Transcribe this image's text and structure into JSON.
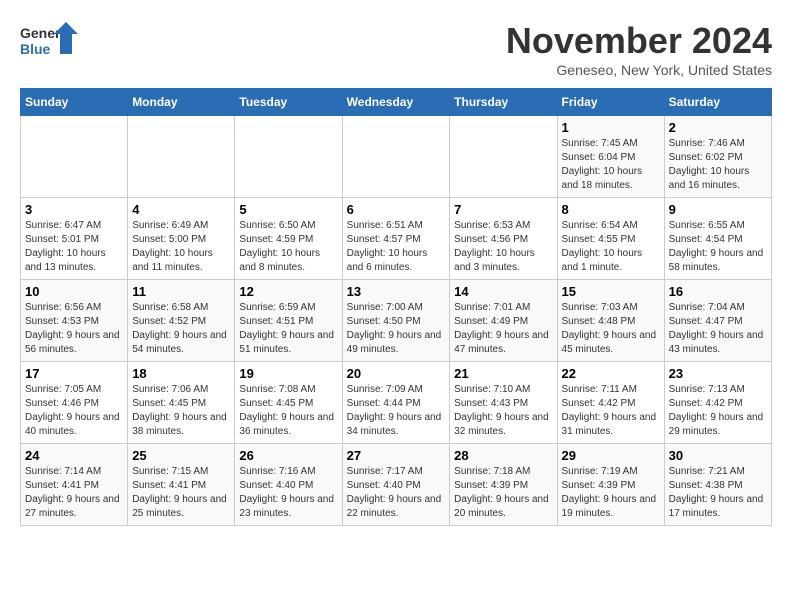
{
  "logo": {
    "line1": "General",
    "line2": "Blue"
  },
  "title": "November 2024",
  "location": "Geneseo, New York, United States",
  "weekdays": [
    "Sunday",
    "Monday",
    "Tuesday",
    "Wednesday",
    "Thursday",
    "Friday",
    "Saturday"
  ],
  "weeks": [
    [
      {
        "day": "",
        "info": ""
      },
      {
        "day": "",
        "info": ""
      },
      {
        "day": "",
        "info": ""
      },
      {
        "day": "",
        "info": ""
      },
      {
        "day": "",
        "info": ""
      },
      {
        "day": "1",
        "info": "Sunrise: 7:45 AM\nSunset: 6:04 PM\nDaylight: 10 hours and 18 minutes."
      },
      {
        "day": "2",
        "info": "Sunrise: 7:46 AM\nSunset: 6:02 PM\nDaylight: 10 hours and 16 minutes."
      }
    ],
    [
      {
        "day": "3",
        "info": "Sunrise: 6:47 AM\nSunset: 5:01 PM\nDaylight: 10 hours and 13 minutes."
      },
      {
        "day": "4",
        "info": "Sunrise: 6:49 AM\nSunset: 5:00 PM\nDaylight: 10 hours and 11 minutes."
      },
      {
        "day": "5",
        "info": "Sunrise: 6:50 AM\nSunset: 4:59 PM\nDaylight: 10 hours and 8 minutes."
      },
      {
        "day": "6",
        "info": "Sunrise: 6:51 AM\nSunset: 4:57 PM\nDaylight: 10 hours and 6 minutes."
      },
      {
        "day": "7",
        "info": "Sunrise: 6:53 AM\nSunset: 4:56 PM\nDaylight: 10 hours and 3 minutes."
      },
      {
        "day": "8",
        "info": "Sunrise: 6:54 AM\nSunset: 4:55 PM\nDaylight: 10 hours and 1 minute."
      },
      {
        "day": "9",
        "info": "Sunrise: 6:55 AM\nSunset: 4:54 PM\nDaylight: 9 hours and 58 minutes."
      }
    ],
    [
      {
        "day": "10",
        "info": "Sunrise: 6:56 AM\nSunset: 4:53 PM\nDaylight: 9 hours and 56 minutes."
      },
      {
        "day": "11",
        "info": "Sunrise: 6:58 AM\nSunset: 4:52 PM\nDaylight: 9 hours and 54 minutes."
      },
      {
        "day": "12",
        "info": "Sunrise: 6:59 AM\nSunset: 4:51 PM\nDaylight: 9 hours and 51 minutes."
      },
      {
        "day": "13",
        "info": "Sunrise: 7:00 AM\nSunset: 4:50 PM\nDaylight: 9 hours and 49 minutes."
      },
      {
        "day": "14",
        "info": "Sunrise: 7:01 AM\nSunset: 4:49 PM\nDaylight: 9 hours and 47 minutes."
      },
      {
        "day": "15",
        "info": "Sunrise: 7:03 AM\nSunset: 4:48 PM\nDaylight: 9 hours and 45 minutes."
      },
      {
        "day": "16",
        "info": "Sunrise: 7:04 AM\nSunset: 4:47 PM\nDaylight: 9 hours and 43 minutes."
      }
    ],
    [
      {
        "day": "17",
        "info": "Sunrise: 7:05 AM\nSunset: 4:46 PM\nDaylight: 9 hours and 40 minutes."
      },
      {
        "day": "18",
        "info": "Sunrise: 7:06 AM\nSunset: 4:45 PM\nDaylight: 9 hours and 38 minutes."
      },
      {
        "day": "19",
        "info": "Sunrise: 7:08 AM\nSunset: 4:45 PM\nDaylight: 9 hours and 36 minutes."
      },
      {
        "day": "20",
        "info": "Sunrise: 7:09 AM\nSunset: 4:44 PM\nDaylight: 9 hours and 34 minutes."
      },
      {
        "day": "21",
        "info": "Sunrise: 7:10 AM\nSunset: 4:43 PM\nDaylight: 9 hours and 32 minutes."
      },
      {
        "day": "22",
        "info": "Sunrise: 7:11 AM\nSunset: 4:42 PM\nDaylight: 9 hours and 31 minutes."
      },
      {
        "day": "23",
        "info": "Sunrise: 7:13 AM\nSunset: 4:42 PM\nDaylight: 9 hours and 29 minutes."
      }
    ],
    [
      {
        "day": "24",
        "info": "Sunrise: 7:14 AM\nSunset: 4:41 PM\nDaylight: 9 hours and 27 minutes."
      },
      {
        "day": "25",
        "info": "Sunrise: 7:15 AM\nSunset: 4:41 PM\nDaylight: 9 hours and 25 minutes."
      },
      {
        "day": "26",
        "info": "Sunrise: 7:16 AM\nSunset: 4:40 PM\nDaylight: 9 hours and 23 minutes."
      },
      {
        "day": "27",
        "info": "Sunrise: 7:17 AM\nSunset: 4:40 PM\nDaylight: 9 hours and 22 minutes."
      },
      {
        "day": "28",
        "info": "Sunrise: 7:18 AM\nSunset: 4:39 PM\nDaylight: 9 hours and 20 minutes."
      },
      {
        "day": "29",
        "info": "Sunrise: 7:19 AM\nSunset: 4:39 PM\nDaylight: 9 hours and 19 minutes."
      },
      {
        "day": "30",
        "info": "Sunrise: 7:21 AM\nSunset: 4:38 PM\nDaylight: 9 hours and 17 minutes."
      }
    ]
  ]
}
